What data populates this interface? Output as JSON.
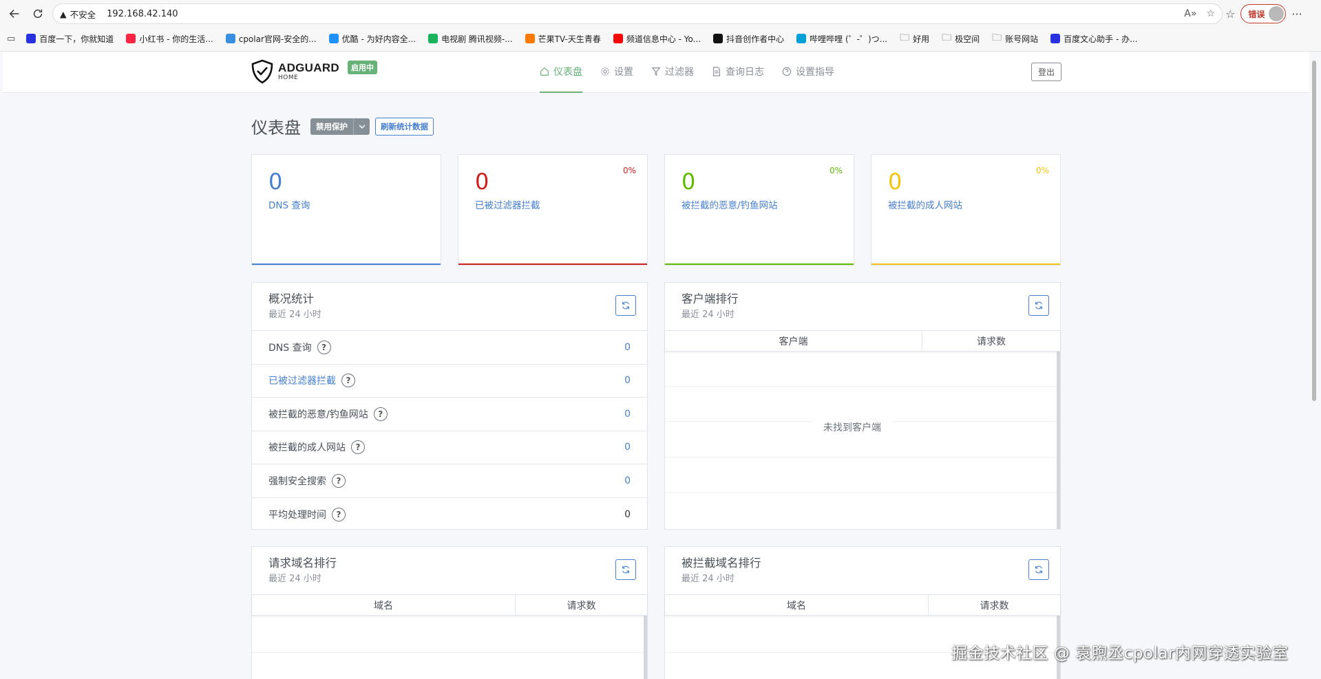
{
  "browser": {
    "security_label": "不安全",
    "url": "192.168.42.140",
    "error_label": "错误",
    "bookmarks": [
      {
        "label": "百度一下，你就知道",
        "color": "#2932e1"
      },
      {
        "label": "小红书 - 你的生活...",
        "color": "#ff2442"
      },
      {
        "label": "cpolar官网-安全的...",
        "color": "#3b8fe0"
      },
      {
        "label": "优酷 - 为好内容全...",
        "color": "#1e90ff"
      },
      {
        "label": "电视剧 腾讯视频-...",
        "color": "#19b35c"
      },
      {
        "label": "芒果TV-天生青春",
        "color": "#ff7a00"
      },
      {
        "label": "频道信息中心 - Yo...",
        "color": "#ff0000"
      },
      {
        "label": "抖音创作者中心",
        "color": "#111111"
      },
      {
        "label": "哔哩哔哩 (゜-゜)つ...",
        "color": "#00a1d6"
      },
      {
        "label": "好用",
        "color": "folder"
      },
      {
        "label": "极空间",
        "color": "folder"
      },
      {
        "label": "账号网站",
        "color": "folder"
      },
      {
        "label": "百度文心助手 - 办...",
        "color": "#2932e1"
      }
    ]
  },
  "header": {
    "logo_main": "ADGUARD",
    "logo_sub": "HOME",
    "status_badge": "启用中",
    "nav": [
      {
        "label": "仪表盘",
        "icon": "home-icon",
        "active": true
      },
      {
        "label": "设置",
        "icon": "gear-icon"
      },
      {
        "label": "过滤器",
        "icon": "filter-icon"
      },
      {
        "label": "查询日志",
        "icon": "document-icon"
      },
      {
        "label": "设置指导",
        "icon": "help-circle-icon"
      }
    ],
    "logout_label": "登出"
  },
  "page": {
    "title": "仪表盘",
    "disable_button": "禁用保护",
    "refresh_stats_button": "刷新统计数据"
  },
  "stats": [
    {
      "value": "0",
      "label": "DNS 查询",
      "pct": "",
      "color": "#467fcf"
    },
    {
      "value": "0",
      "label": "已被过滤器拦截",
      "pct": "0%",
      "color": "#cd201f"
    },
    {
      "value": "0",
      "label": "被拦截的恶意/钓鱼网站",
      "pct": "0%",
      "color": "#5eba00"
    },
    {
      "value": "0",
      "label": "被拦截的成人网站",
      "pct": "0%",
      "color": "#f1c40f"
    }
  ],
  "summary": {
    "title": "概况统计",
    "subtitle": "最近 24 小时",
    "rows": [
      {
        "label": "DNS 查询",
        "value": "0"
      },
      {
        "label": "已被过滤器拦截",
        "value": "0"
      },
      {
        "label": "被拦截的恶意/钓鱼网站",
        "value": "0"
      },
      {
        "label": "被拦截的成人网站",
        "value": "0"
      },
      {
        "label": "强制安全搜索",
        "value": "0"
      },
      {
        "label": "平均处理时间",
        "value": "0"
      }
    ]
  },
  "clients": {
    "title": "客户端排行",
    "subtitle": "最近 24 小时",
    "col1": "客户端",
    "col2": "请求数",
    "empty": "未找到客户端"
  },
  "queried_domains": {
    "title": "请求域名排行",
    "subtitle": "最近 24 小时",
    "col1": "域名",
    "col2": "请求数"
  },
  "blocked_domains": {
    "title": "被拦截域名排行",
    "subtitle": "最近 24 小时",
    "col1": "域名",
    "col2": "请求数"
  },
  "watermark": "掘金技术社区 @ 袁煦丞cpolar内网穿透实验室"
}
